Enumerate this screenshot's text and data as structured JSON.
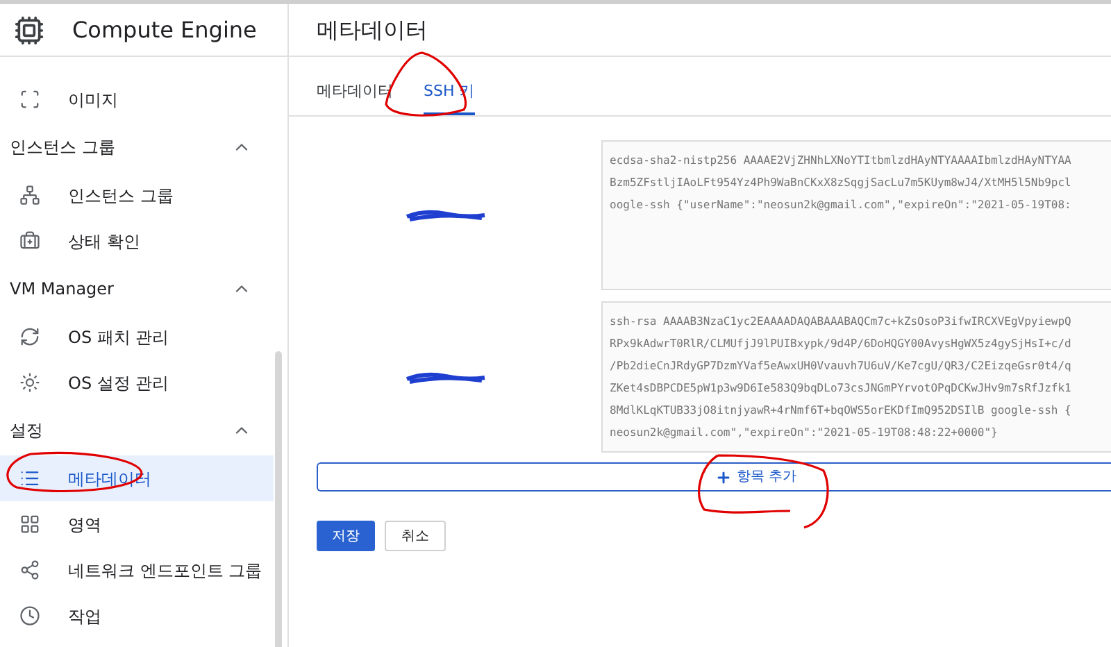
{
  "sidebar": {
    "title": "Compute Engine",
    "items": [
      {
        "label": "이미지",
        "selected": false
      }
    ],
    "groups": [
      {
        "title": "인스턴스 그룹",
        "expanded": true,
        "items": [
          {
            "label": "인스턴스 그룹",
            "selected": false
          },
          {
            "label": "상태 확인",
            "selected": false
          }
        ]
      },
      {
        "title": "VM Manager",
        "expanded": true,
        "items": [
          {
            "label": "OS 패치 관리",
            "selected": false
          },
          {
            "label": "OS 설정 관리",
            "selected": false
          }
        ]
      },
      {
        "title": "설정",
        "expanded": true,
        "items": [
          {
            "label": "메타데이터",
            "selected": true
          },
          {
            "label": "영역",
            "selected": false
          },
          {
            "label": "네트워크 엔드포인트 그룹",
            "selected": false
          },
          {
            "label": "작업",
            "selected": false
          }
        ]
      }
    ]
  },
  "page_title": "메타데이터",
  "tabs": [
    {
      "label": "메타데이터",
      "selected": false
    },
    {
      "label": "SSH 키",
      "selected": true
    }
  ],
  "ssh_keys": [
    {
      "lines": [
        "ecdsa-sha2-nistp256 AAAAE2VjZHNhLXNoYTItbmlzdHAyNTYAAAAIbmlzdHAyNTYAA",
        "Bzm5ZFstljIAoLFt954Yz4Ph9WaBnCKxX8zSqgjSacLu7m5KUym8wJ4/XtMH5l5Nb9pcl",
        "oogle-ssh {\"userName\":\"neosun2k@gmail.com\",\"expireOn\":\"2021-05-19T08:"
      ]
    },
    {
      "lines": [
        "ssh-rsa AAAAB3NzaC1yc2EAAAADAQABAAABAQCm7c+kZsOsoP3ifwIRCXVEgVpyiewpQ",
        "RPx9kAdwrT0RlR/CLMUfjJ9lPUIBxypk/9d4P/6DoHQGY00AvysHgWX5z4gySjHsI+c/d",
        "/Pb2dieCnJRdyGP7DzmYVaf5eAwxUH0Vvauvh7U6uV/Ke7cgU/QR3/C2EizqeGsr0t4/q",
        "ZKet4sDBPCDE5pW1p3w9D6Ie583Q9bqDLo73csJNGmPYrvotOPqDCKwJHv9m7sRfJzfk1",
        "8MdlKLqKTUB33jO8itnjyawR+4rNmf6T+bqOWS5orEKDfImQ952DSIlB google-ssh {",
        "neosun2k@gmail.com\",\"expireOn\":\"2021-05-19T08:48:22+0000\"}"
      ]
    }
  ],
  "add_button": {
    "label": "항목 추가"
  },
  "buttons": [
    {
      "label": "저장",
      "kind": "primary"
    },
    {
      "label": "취소",
      "kind": "secondary"
    }
  ]
}
